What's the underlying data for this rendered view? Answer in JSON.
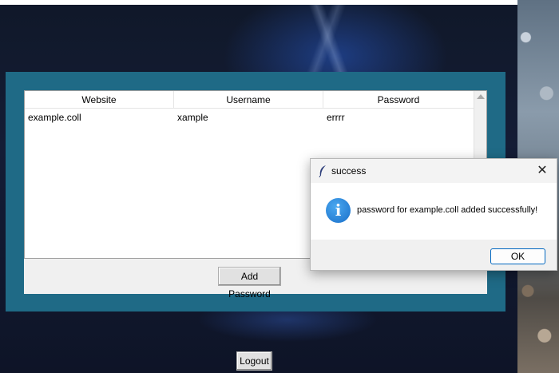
{
  "app": {
    "table": {
      "columns": [
        "Website",
        "Username",
        "Password"
      ],
      "rows": [
        {
          "website": "example.coll",
          "username": "xample",
          "password": "errrr"
        }
      ]
    },
    "add_button_label": "Add Password",
    "logout_button_label": "Logout"
  },
  "dialog": {
    "title": "success",
    "message": "password for example.coll added successfully!",
    "ok_label": "OK",
    "close_glyph": "✕",
    "info_glyph": "i",
    "icons": [
      "feather-icon",
      "info-icon",
      "close-icon"
    ]
  },
  "colors": {
    "app_frame": "#1f6a86",
    "info_blue": "#1a6fc9",
    "ok_border": "#0067c0"
  }
}
